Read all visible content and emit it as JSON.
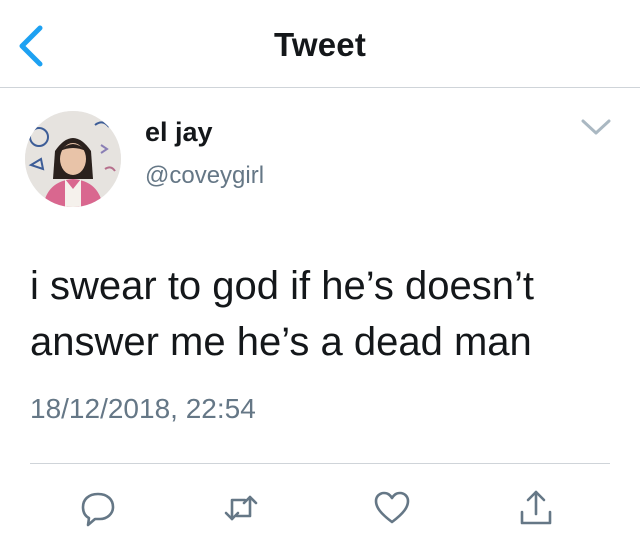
{
  "nav": {
    "title": "Tweet",
    "back_icon": "chevron-left-icon"
  },
  "tweet": {
    "author_name": "el jay",
    "author_handle": "@coveygirl",
    "text_lines": [
      "i swear to god if he’s doesn’t",
      "answer me he’s a dead man"
    ],
    "timestamp": "18/12/2018, 22:54",
    "menu_icon": "chevron-down-icon"
  },
  "actions": [
    {
      "icon": "reply-icon"
    },
    {
      "icon": "retweet-icon"
    },
    {
      "icon": "like-icon"
    },
    {
      "icon": "share-icon"
    }
  ],
  "colors": {
    "accent": "#1da1f2",
    "text_primary": "#14171a",
    "text_secondary": "#657786",
    "divider": "#cfd4d9"
  }
}
